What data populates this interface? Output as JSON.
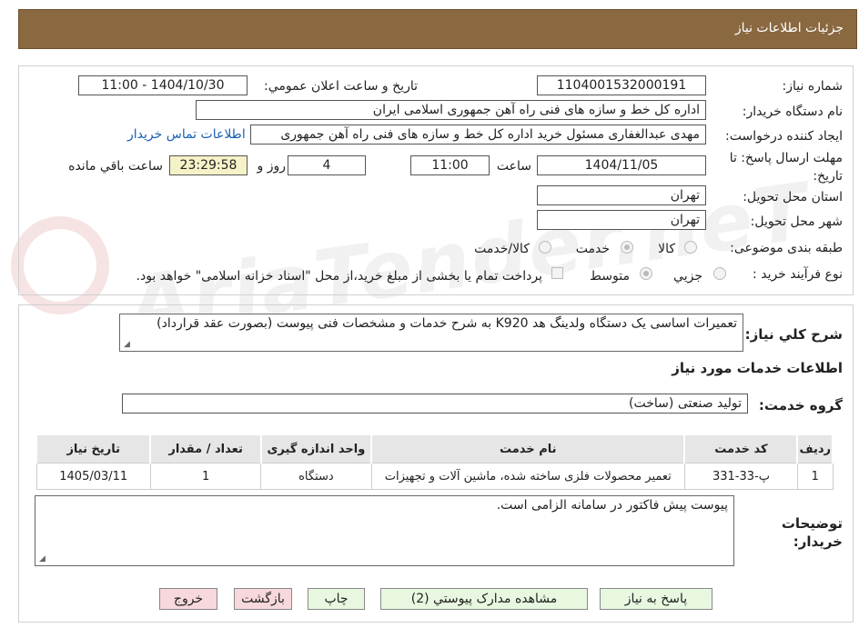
{
  "header": {
    "title": "جزئیات اطلاعات نیاز"
  },
  "watermark": "AriaTender.neT",
  "form": {
    "need_number": {
      "label": "شماره نیاز:",
      "value": "1104001532000191"
    },
    "announce": {
      "label": "تاریخ و ساعت اعلان عمومي:",
      "value": "1404/10/30 - 11:00"
    },
    "buyer_org": {
      "label": "نام دستگاه خریدار:",
      "value": "اداره کل خط و سازه های فنی راه آهن جمهوری اسلامی ایران"
    },
    "requester": {
      "label": "ایجاد کننده درخواست:",
      "value": "مهدی عبدالغفاری مسئول خرید اداره کل خط و سازه های فنی راه آهن جمهوری",
      "contact_link": "اطلاعات تماس خریدار"
    },
    "deadline": {
      "label": "مهلت ارسال پاسخ: تا تاریخ:",
      "date": "1404/11/05",
      "time_label": "ساعت",
      "time": "11:00",
      "days": "4",
      "days_label": "روز و",
      "remaining": "23:29:58",
      "remaining_label": "ساعت باقي مانده"
    },
    "province": {
      "label": "استان محل تحویل:",
      "value": "تهران"
    },
    "city": {
      "label": "شهر محل تحویل:",
      "value": "تهران"
    },
    "category": {
      "label": "طبقه بندی موضوعی:",
      "options": [
        "کالا",
        "خدمت",
        "کالا/خدمت"
      ],
      "selected": "خدمت"
    },
    "process": {
      "label": "نوع فرآیند خرید :",
      "options": [
        "جزيي",
        "متوسط"
      ],
      "selected": "متوسط",
      "note": "پرداخت تمام یا بخشی از مبلغ خرید،از محل \"اسناد خزانه اسلامی\" خواهد بود."
    }
  },
  "summary": {
    "label": "شرح کلي نیاز:",
    "value": "تعمیرات اساسی یک دستگاه ولدینگ هد K920 به شرح خدمات و مشخصات فنی پیوست (بصورت عقد قرارداد)"
  },
  "services_title": "اطلاعات خدمات مورد نیاز",
  "service_group": {
    "label": "گروه خدمت:",
    "value": "تولید صنعتی (ساخت)"
  },
  "table": {
    "headers": [
      "ردیف",
      "کد خدمت",
      "نام خدمت",
      "واحد اندازه گیری",
      "تعداد / مقدار",
      "تاریخ نیاز"
    ],
    "rows": [
      [
        "1",
        "پ-33-331",
        "تعمیر محصولات فلزی ساخته شده، ماشین آلات و تجهیزات",
        "دستگاه",
        "1",
        "1405/03/11"
      ]
    ]
  },
  "buyer_notes": {
    "label": "توضیحات خریدار:",
    "value": "پیوست پیش فاکتور در سامانه الزامی است."
  },
  "buttons": {
    "reply": "پاسخ به نیاز",
    "attachments": "مشاهده مدارک پیوستي (2)",
    "print": "چاپ",
    "back": "بازگشت",
    "exit": "خروج"
  }
}
